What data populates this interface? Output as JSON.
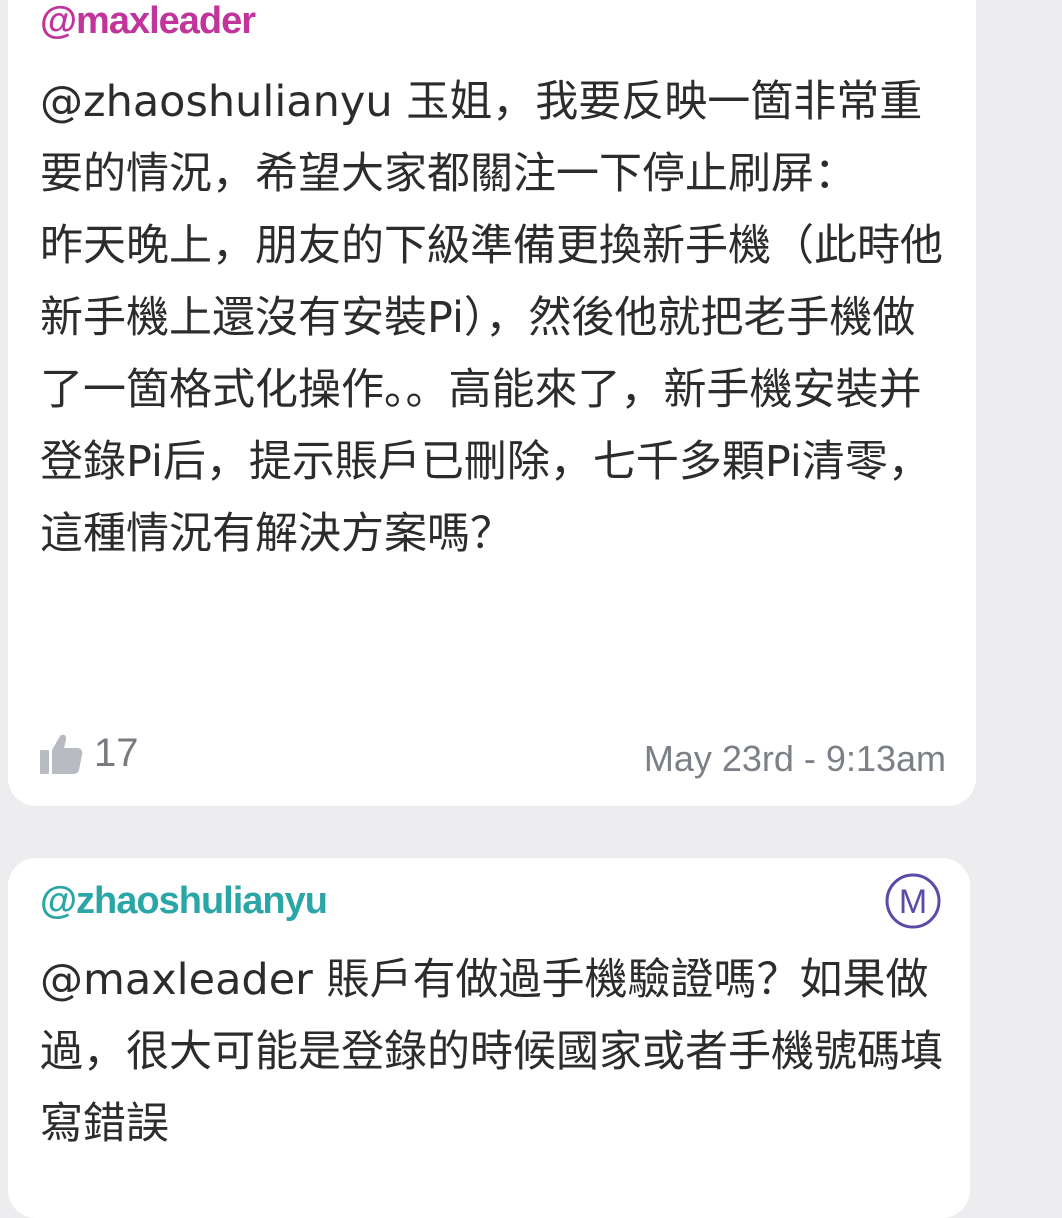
{
  "comments": [
    {
      "author": "@maxleader",
      "author_color": "#c1349b",
      "text": "@zhaoshulianyu 玉姐，我要反映一箇非常重要的情況，希望大家都關注一下停止刷屏：\n昨天晚上，朋友的下級準備更換新手機（此時他新手機上還沒有安裝Pi），然後他就把老手機做了一箇格式化操作。。高能來了，新手機安裝并登錄Pi后，提示賬戶已刪除，七千多顆Pi清零，這種情況有解決方案嗎？",
      "likes": "17",
      "timestamp": "May 23rd - 9:13am"
    },
    {
      "author": "@zhaoshulianyu",
      "author_color": "#2ba6a6",
      "badge_label": "M",
      "badge_color": "#5b4aa6",
      "text": "@maxleader 賬戶有做過手機驗證嗎？如果做過，很大可能是登錄的時候國家或者手機號碼填寫錯誤"
    }
  ]
}
